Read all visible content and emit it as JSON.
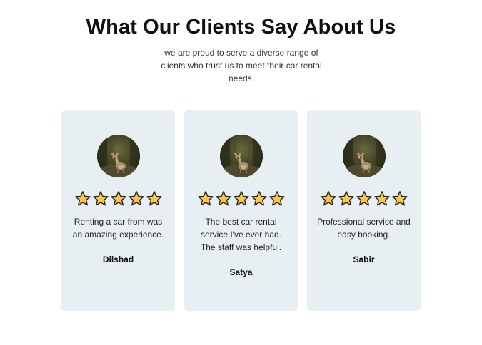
{
  "section": {
    "title": "What Our Clients Say About Us",
    "subtitle": "we are proud to serve a diverse range of clients who trust us to meet their car rental needs."
  },
  "colors": {
    "card_background": "#e8eff3",
    "star_fill": "#f7c64a",
    "star_outline": "#222222"
  },
  "testimonials": [
    {
      "avatar_icon": "deer-photo",
      "rating": 5,
      "text": "Renting a car from was an amazing experience.",
      "name": "Dilshad"
    },
    {
      "avatar_icon": "deer-photo",
      "rating": 5,
      "text": "The best car rental service I've ever had. The staff was helpful.",
      "name": "Satya"
    },
    {
      "avatar_icon": "deer-photo",
      "rating": 5,
      "text": "Professional service and easy booking.",
      "name": "Sabir"
    }
  ]
}
